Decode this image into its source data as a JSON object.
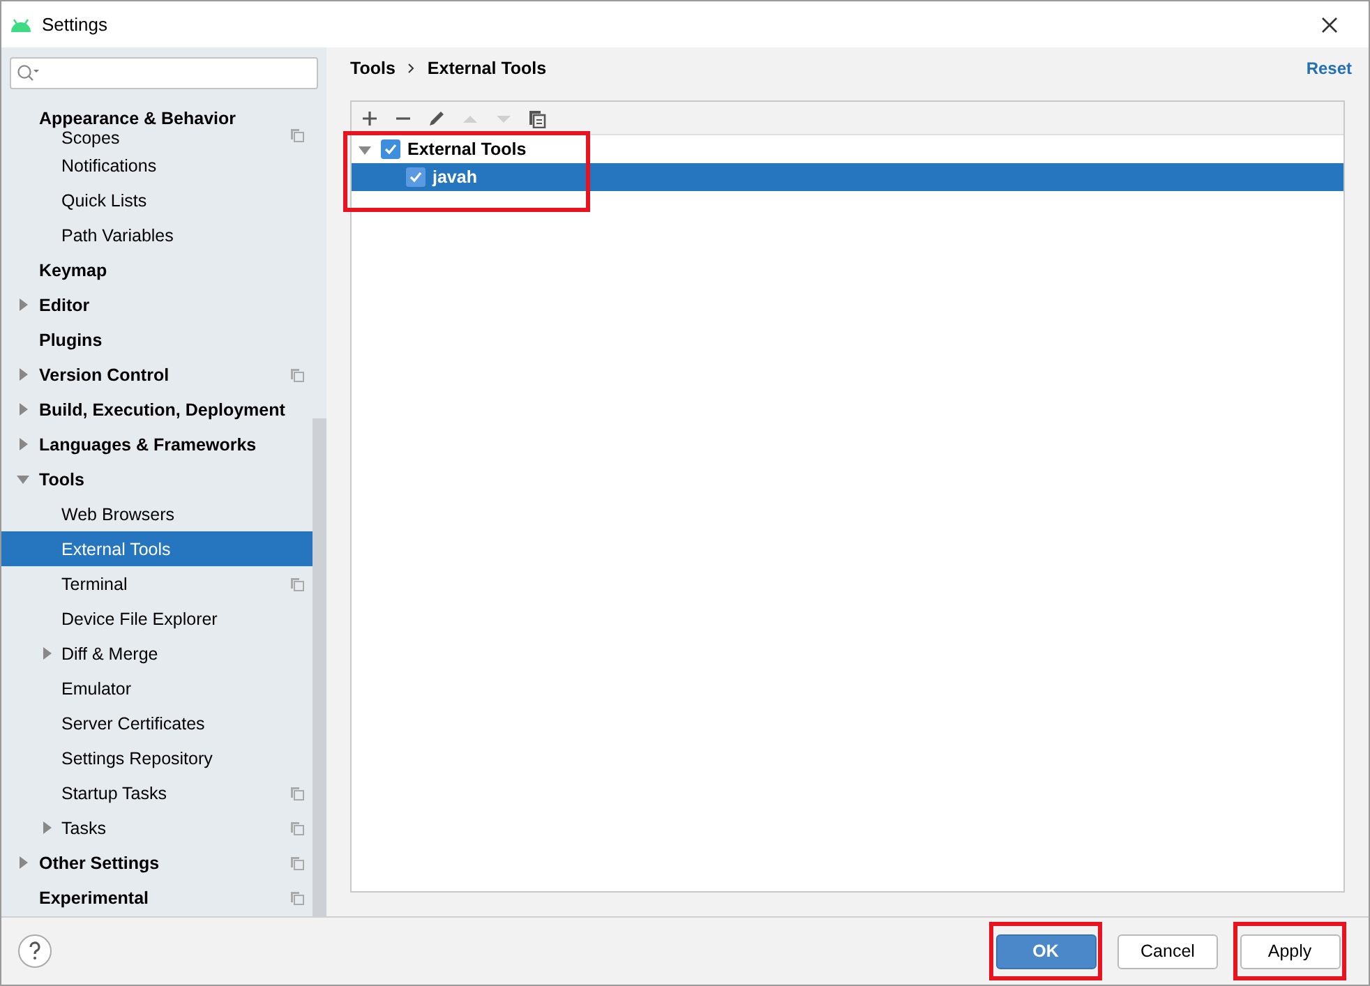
{
  "window": {
    "title": "Settings"
  },
  "sidebar": {
    "items": [
      {
        "label": "Appearance & Behavior",
        "children": [
          {
            "label": "Scopes",
            "project_scoped": true,
            "selected": false
          },
          {
            "label": "Notifications",
            "selected": false
          },
          {
            "label": "Quick Lists",
            "selected": false
          },
          {
            "label": "Path Variables",
            "selected": false
          }
        ]
      },
      {
        "label": "Keymap",
        "selected": false
      },
      {
        "label": "Editor",
        "expanded": false,
        "selected": false
      },
      {
        "label": "Plugins",
        "selected": false
      },
      {
        "label": "Version Control",
        "expanded": false,
        "project_scoped": true,
        "selected": false
      },
      {
        "label": "Build, Execution, Deployment",
        "expanded": false,
        "selected": false
      },
      {
        "label": "Languages & Frameworks",
        "expanded": false,
        "selected": false
      },
      {
        "label": "Tools",
        "expanded": true,
        "selected": false,
        "children": [
          {
            "label": "Web Browsers",
            "selected": false
          },
          {
            "label": "External Tools",
            "selected": true
          },
          {
            "label": "Terminal",
            "project_scoped": true,
            "selected": false
          },
          {
            "label": "Device File Explorer",
            "selected": false
          },
          {
            "label": "Diff & Merge",
            "expanded": false,
            "selected": false
          },
          {
            "label": "Emulator",
            "selected": false
          },
          {
            "label": "Server Certificates",
            "selected": false
          },
          {
            "label": "Settings Repository",
            "selected": false
          },
          {
            "label": "Startup Tasks",
            "project_scoped": true,
            "selected": false
          },
          {
            "label": "Tasks",
            "expanded": false,
            "project_scoped": true,
            "selected": false
          }
        ]
      },
      {
        "label": "Other Settings",
        "expanded": false,
        "project_scoped": true,
        "selected": false
      },
      {
        "label": "Experimental",
        "project_scoped": true,
        "selected": false
      }
    ]
  },
  "breadcrumb": [
    "Tools",
    "External Tools"
  ],
  "reset_link": "Reset",
  "tools_tree": {
    "highlighted": true,
    "items": [
      {
        "label": "External Tools",
        "checked": true,
        "expanded": true,
        "selected": false,
        "children": [
          {
            "label": "javah",
            "checked": true,
            "selected": true
          }
        ]
      }
    ]
  },
  "buttons": [
    {
      "label": "OK",
      "kind": "primary",
      "highlighted": true
    },
    {
      "label": "Cancel",
      "kind": "normal",
      "highlighted": false
    },
    {
      "label": "Apply",
      "kind": "normal",
      "highlighted": true
    }
  ]
}
